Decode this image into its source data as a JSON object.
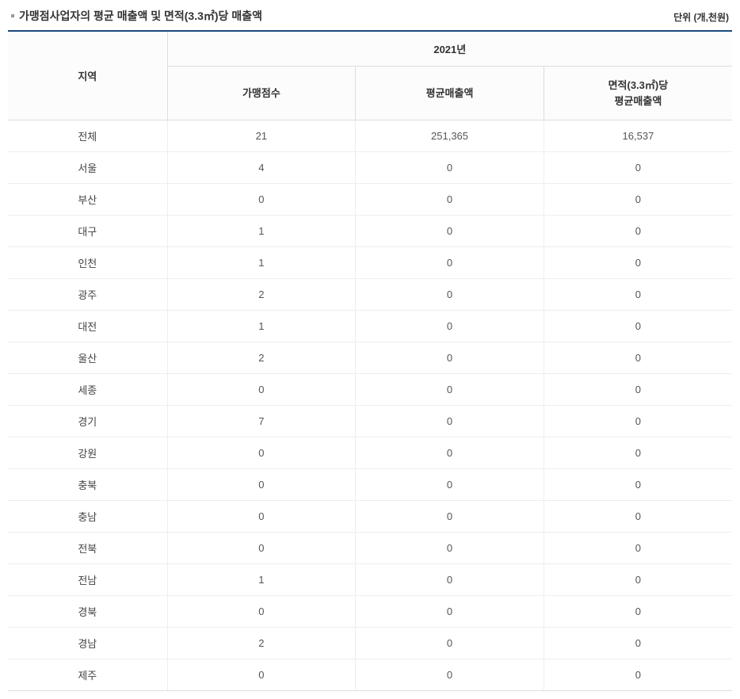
{
  "title": "가맹점사업자의 평균 매출액 및 면적(3.3㎡)당 매출액",
  "unit": "단위 (개,천원)",
  "headers": {
    "region": "지역",
    "year": "2021년",
    "col1": "가맹점수",
    "col2": "평균매출액",
    "col3_line1": "면적(3.3㎡)당",
    "col3_line2": "평균매출액"
  },
  "chart_data": {
    "type": "table",
    "title": "가맹점사업자의 평균 매출액 및 면적(3.3㎡)당 매출액",
    "columns": [
      "지역",
      "가맹점수",
      "평균매출액",
      "면적(3.3㎡)당 평균매출액"
    ],
    "rows": [
      {
        "region": "전체",
        "count": "21",
        "avg_sales": "251,365",
        "area_sales": "16,537"
      },
      {
        "region": "서울",
        "count": "4",
        "avg_sales": "0",
        "area_sales": "0"
      },
      {
        "region": "부산",
        "count": "0",
        "avg_sales": "0",
        "area_sales": "0"
      },
      {
        "region": "대구",
        "count": "1",
        "avg_sales": "0",
        "area_sales": "0"
      },
      {
        "region": "인천",
        "count": "1",
        "avg_sales": "0",
        "area_sales": "0"
      },
      {
        "region": "광주",
        "count": "2",
        "avg_sales": "0",
        "area_sales": "0"
      },
      {
        "region": "대전",
        "count": "1",
        "avg_sales": "0",
        "area_sales": "0"
      },
      {
        "region": "울산",
        "count": "2",
        "avg_sales": "0",
        "area_sales": "0"
      },
      {
        "region": "세종",
        "count": "0",
        "avg_sales": "0",
        "area_sales": "0"
      },
      {
        "region": "경기",
        "count": "7",
        "avg_sales": "0",
        "area_sales": "0"
      },
      {
        "region": "강원",
        "count": "0",
        "avg_sales": "0",
        "area_sales": "0"
      },
      {
        "region": "충북",
        "count": "0",
        "avg_sales": "0",
        "area_sales": "0"
      },
      {
        "region": "충남",
        "count": "0",
        "avg_sales": "0",
        "area_sales": "0"
      },
      {
        "region": "전북",
        "count": "0",
        "avg_sales": "0",
        "area_sales": "0"
      },
      {
        "region": "전남",
        "count": "1",
        "avg_sales": "0",
        "area_sales": "0"
      },
      {
        "region": "경북",
        "count": "0",
        "avg_sales": "0",
        "area_sales": "0"
      },
      {
        "region": "경남",
        "count": "2",
        "avg_sales": "0",
        "area_sales": "0"
      },
      {
        "region": "제주",
        "count": "0",
        "avg_sales": "0",
        "area_sales": "0"
      }
    ]
  }
}
